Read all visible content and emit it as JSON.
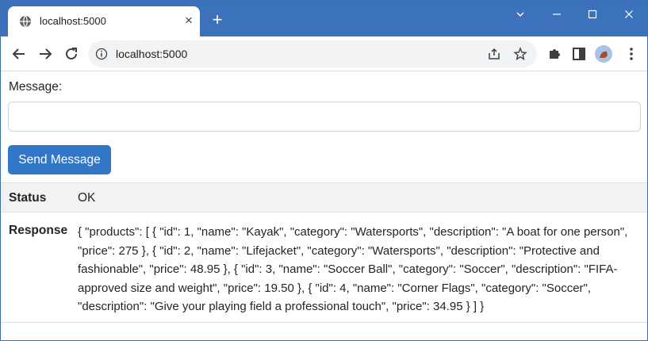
{
  "browser": {
    "tab_title": "localhost:5000",
    "new_tab_label": "+",
    "url": "localhost:5000"
  },
  "form": {
    "message_label": "Message:",
    "message_value": "",
    "send_button_label": "Send Message"
  },
  "results": {
    "status_label": "Status",
    "status_value": "OK",
    "response_label": "Response",
    "response_value": "{ \"products\": [ { \"id\": 1, \"name\": \"Kayak\", \"category\": \"Watersports\", \"description\": \"A boat for one person\", \"price\": 275 }, { \"id\": 2, \"name\": \"Lifejacket\", \"category\": \"Watersports\", \"description\": \"Protective and fashionable\", \"price\": 48.95 }, { \"id\": 3, \"name\": \"Soccer Ball\", \"category\": \"Soccer\", \"description\": \"FIFA-approved size and weight\", \"price\": 19.50 }, { \"id\": 4, \"name\": \"Corner Flags\", \"category\": \"Soccer\", \"description\": \"Give your playing field a professional touch\", \"price\": 34.95 } ] }"
  },
  "colors": {
    "titlebar": "#3b72bb",
    "button": "#3176c7",
    "status_row": "#f2f2f2"
  }
}
